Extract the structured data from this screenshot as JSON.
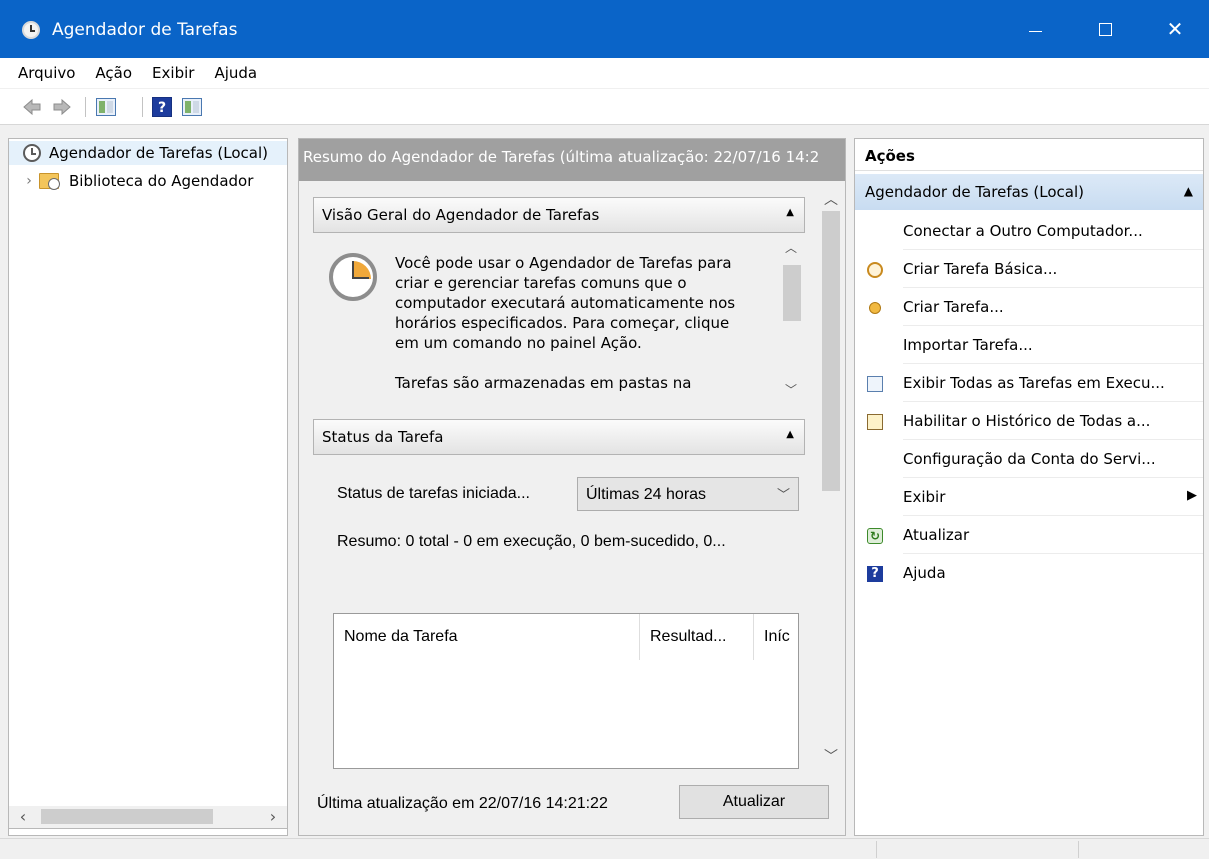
{
  "window": {
    "title": "Agendador de Tarefas",
    "accent_color": "#0a64c8"
  },
  "menu": [
    "Arquivo",
    "Ação",
    "Exibir",
    "Ajuda"
  ],
  "toolbar": {
    "back_icon": "back-arrow-icon",
    "forward_icon": "forward-arrow-icon",
    "help_glyph": "?"
  },
  "tree": {
    "root_label": "Agendador de Tarefas (Local)",
    "child_label": "Biblioteca do Agendador"
  },
  "center": {
    "header": "Resumo do Agendador de Tarefas (última atualização: 22/07/16 14:2",
    "overview": {
      "title": "Visão Geral do Agendador de Tarefas",
      "paragraph1": "Você pode usar o Agendador de Tarefas para criar e gerenciar tarefas comuns que o computador executará automaticamente nos horários especificados. Para começar, clique em um comando no painel Ação.",
      "paragraph2": "Tarefas são armazenadas em pastas na"
    },
    "status": {
      "title": "Status da Tarefa",
      "label": "Status de tarefas iniciada...",
      "select_value": "Últimas 24 horas",
      "summary": "Resumo: 0 total - 0 em execução, 0 bem-sucedido, 0...",
      "columns": [
        "Nome da Tarefa",
        "Resultad...",
        "Iníc"
      ]
    },
    "footer": {
      "last_update": "Última atualização em 22/07/16 14:21:22",
      "refresh_button": "Atualizar"
    }
  },
  "actions": {
    "header": "Ações",
    "group_title": "Agendador de Tarefas (Local)",
    "items": [
      {
        "label": "Conectar a Outro Computador...",
        "icon": "none"
      },
      {
        "label": "Criar Tarefa Básica...",
        "icon": "basic-task-icon"
      },
      {
        "label": "Criar Tarefa...",
        "icon": "create-task-icon"
      },
      {
        "label": "Importar Tarefa...",
        "icon": "none"
      },
      {
        "label": "Exibir Todas as Tarefas em Execu...",
        "icon": "running-tasks-icon"
      },
      {
        "label": "Habilitar o Histórico de Todas a...",
        "icon": "history-icon"
      },
      {
        "label": "Configuração da Conta do Servi...",
        "icon": "none"
      },
      {
        "label": "Exibir",
        "icon": "none"
      },
      {
        "label": "Atualizar",
        "icon": "refresh-icon"
      },
      {
        "label": "Ajuda",
        "icon": "help-icon"
      }
    ]
  }
}
